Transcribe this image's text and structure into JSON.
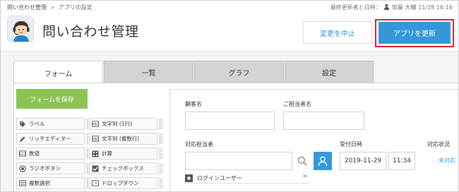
{
  "header": {
    "breadcrumb": [
      "問い合わせ管理",
      "アプリの設定"
    ],
    "breadcrumb_sep": ">",
    "updated_label": "最終更新者と日時：",
    "updated_user": "加藤 大輔",
    "updated_time": "11/28 16:16",
    "app_title": "問い合わせ管理",
    "cancel_label": "変更を中止",
    "update_label": "アプリを更新"
  },
  "tabs": [
    {
      "label": "フォーム",
      "active": true
    },
    {
      "label": "一覧",
      "active": false
    },
    {
      "label": "グラフ",
      "active": false
    },
    {
      "label": "設定",
      "active": false
    }
  ],
  "palette": {
    "save_label": "フォームを保存",
    "items": [
      {
        "label": "ラベル",
        "icon": "tag-icon"
      },
      {
        "label": "文字列 (1行)",
        "icon": "text-single-icon"
      },
      {
        "label": "リッチエディター",
        "icon": "pencil-icon"
      },
      {
        "label": "文字列 (複数行)",
        "icon": "text-multi-icon"
      },
      {
        "label": "数値",
        "icon": "number-icon"
      },
      {
        "label": "計算",
        "icon": "calculator-icon"
      },
      {
        "label": "ラジオボタン",
        "icon": "radio-icon"
      },
      {
        "label": "チェックボックス",
        "icon": "checkbox-icon"
      },
      {
        "label": "複数選択",
        "icon": "multi-select-icon"
      },
      {
        "label": "ドロップダウン",
        "icon": "dropdown-icon"
      }
    ]
  },
  "form": {
    "customer_label": "顧客名",
    "contact_label": "ご担当者名",
    "assignee_label": "対応担当者",
    "received_label": "受付日時",
    "status_label": "対応状況",
    "received_date": "2019-11-29",
    "received_time": "11:34",
    "status_value": "未対応",
    "login_user_chip": "ログインユーザー",
    "chip_close": "×"
  },
  "colors": {
    "accent": "#3498db",
    "save_green": "#8bc453",
    "highlight_red": "#d9232e"
  }
}
